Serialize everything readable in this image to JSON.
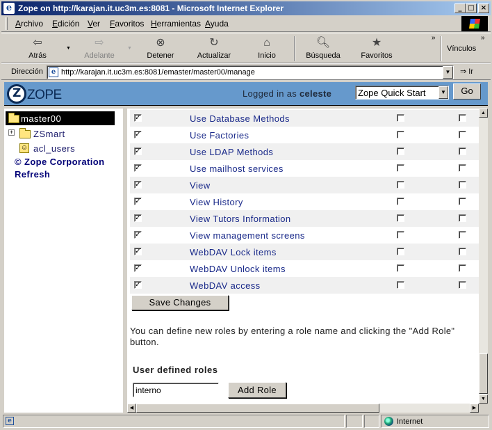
{
  "window": {
    "title": "Zope on http://karajan.it.uc3m.es:8081 - Microsoft Internet Explorer",
    "app_icon": "ie-icon",
    "minimize": "_",
    "maximize": "□",
    "close": "×"
  },
  "menu": {
    "items": [
      "Archivo",
      "Edición",
      "Ver",
      "Favoritos",
      "Herramientas",
      "Ayuda"
    ]
  },
  "toolbar": {
    "back": "Atrás",
    "forward": "Adelante",
    "stop": "Detener",
    "refresh": "Actualizar",
    "home": "Inicio",
    "search": "Búsqueda",
    "favorites": "Favoritos",
    "links": "Vínculos"
  },
  "address": {
    "label": "Dirección",
    "url": "http://karajan.it.uc3m.es:8081/emaster/master00/manage",
    "go": "Ir"
  },
  "zope_header": {
    "logo": "ZOPE",
    "logged_in_prefix": "Logged in as",
    "user": "celeste",
    "quick_start": "Zope Quick Start",
    "go": "Go"
  },
  "tree": {
    "root": "master00",
    "items": [
      {
        "label": "ZSmart",
        "icon": "folder-icon",
        "expandable": true
      },
      {
        "label": "acl_users",
        "icon": "user-folder-icon",
        "expandable": false
      }
    ],
    "copyright": "© Zope Corporation",
    "refresh": "Refresh"
  },
  "permissions": [
    {
      "name": "Use Database Methods",
      "acquire": true,
      "role1": false,
      "role2": false
    },
    {
      "name": "Use Factories",
      "acquire": true,
      "role1": false,
      "role2": false
    },
    {
      "name": "Use LDAP Methods",
      "acquire": true,
      "role1": false,
      "role2": false
    },
    {
      "name": "Use mailhost services",
      "acquire": true,
      "role1": false,
      "role2": false
    },
    {
      "name": "View",
      "acquire": true,
      "role1": false,
      "role2": false
    },
    {
      "name": "View History",
      "acquire": true,
      "role1": false,
      "role2": false
    },
    {
      "name": "View Tutors Information",
      "acquire": true,
      "role1": false,
      "role2": false
    },
    {
      "name": "View management screens",
      "acquire": true,
      "role1": false,
      "role2": false
    },
    {
      "name": "WebDAV Lock items",
      "acquire": true,
      "role1": false,
      "role2": false
    },
    {
      "name": "WebDAV Unlock items",
      "acquire": true,
      "role1": false,
      "role2": false
    },
    {
      "name": "WebDAV access",
      "acquire": true,
      "role1": false,
      "role2": false
    }
  ],
  "save_button": "Save Changes",
  "help_text": "You can define new roles by entering a role name and clicking the \"Add Role\" button.",
  "roles": {
    "title": "User defined roles",
    "input_value": "interno",
    "add_button": "Add Role"
  },
  "status": {
    "zone": "Internet"
  },
  "colors": {
    "zope_bar": "#6699cc",
    "link": "#1a2a8a",
    "titlebar": "#0a246a"
  }
}
